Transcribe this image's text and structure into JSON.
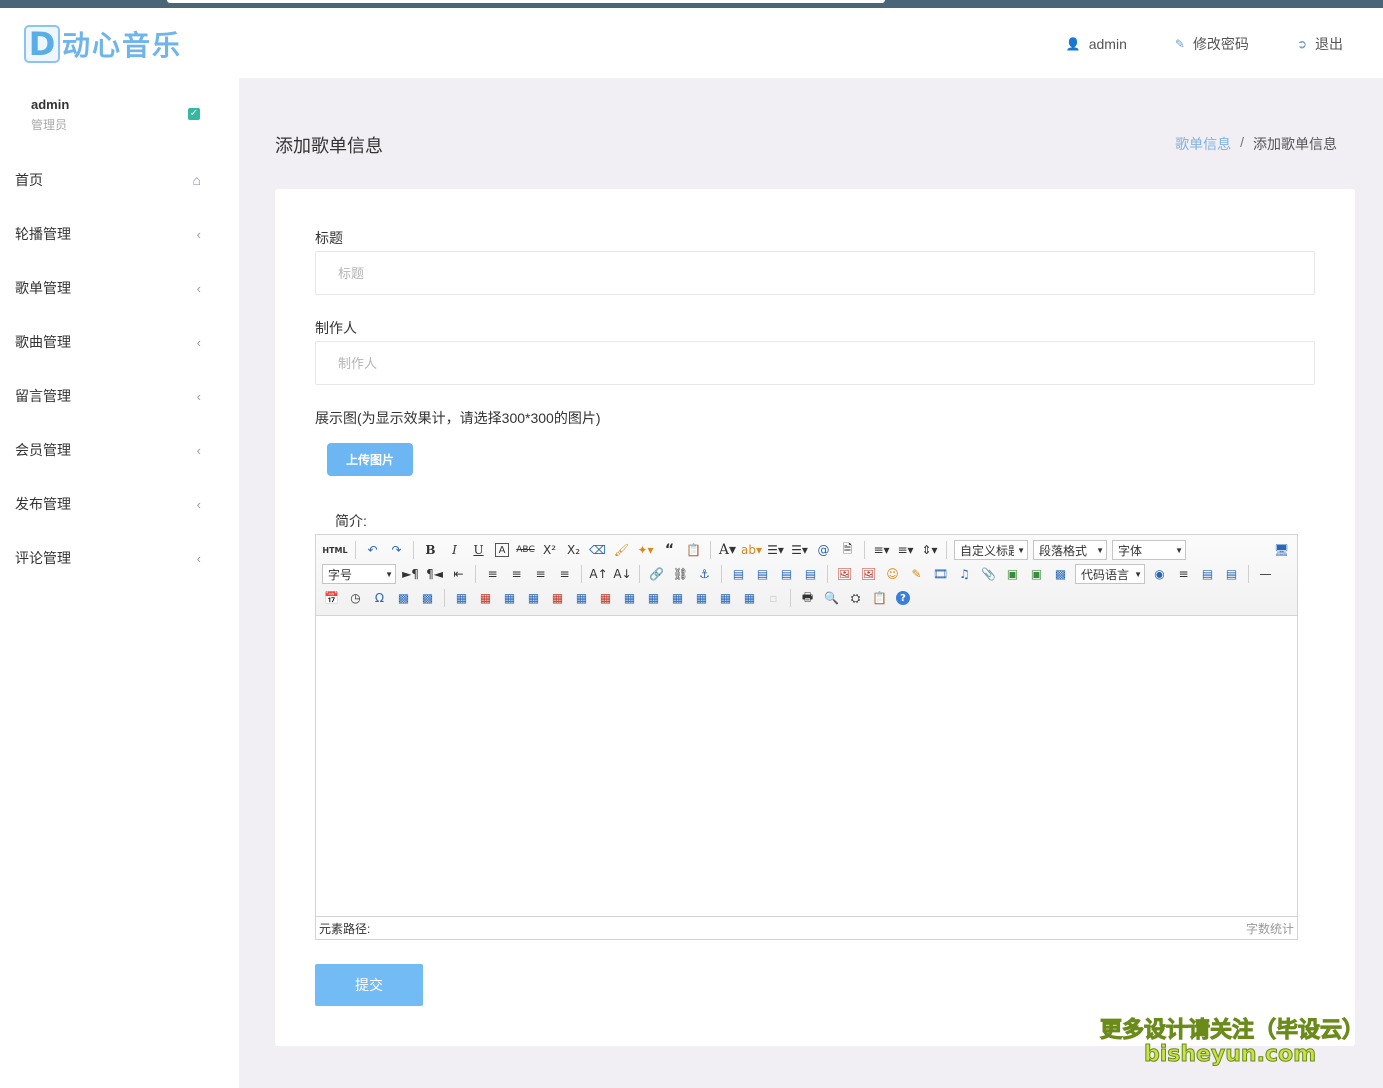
{
  "app": {
    "logo_letter": "D",
    "logo_text": "动心音乐"
  },
  "header": {
    "user_label": "admin",
    "change_password_label": "修改密码",
    "logout_label": "退出"
  },
  "sidebar": {
    "user_name": "admin",
    "user_role": "管理员",
    "items": [
      {
        "label": "首页"
      },
      {
        "label": "轮播管理"
      },
      {
        "label": "歌单管理"
      },
      {
        "label": "歌曲管理"
      },
      {
        "label": "留言管理"
      },
      {
        "label": "会员管理"
      },
      {
        "label": "发布管理"
      },
      {
        "label": "评论管理"
      }
    ]
  },
  "page": {
    "title": "添加歌单信息",
    "breadcrumb_parent": "歌单信息",
    "breadcrumb_sep": "/",
    "breadcrumb_current": "添加歌单信息"
  },
  "form": {
    "title_label": "标题",
    "title_placeholder": "标题",
    "maker_label": "制作人",
    "maker_placeholder": "制作人",
    "image_label": "展示图(为显示效果计，请选择300*300的图片)",
    "upload_button": "上传图片",
    "desc_label": "简介:",
    "submit_button": "提交"
  },
  "editor": {
    "html_button": "HTML",
    "custom_title_select": "自定义标题",
    "paragraph_select": "段落格式",
    "font_select": "字体",
    "size_select": "字号",
    "code_lang_select": "代码语言",
    "element_path_label": "元素路径:",
    "word_count_label": "字数统计"
  },
  "watermark": {
    "line1": "更多设计请关注（毕设云）",
    "line2": "bisheyun.com"
  }
}
